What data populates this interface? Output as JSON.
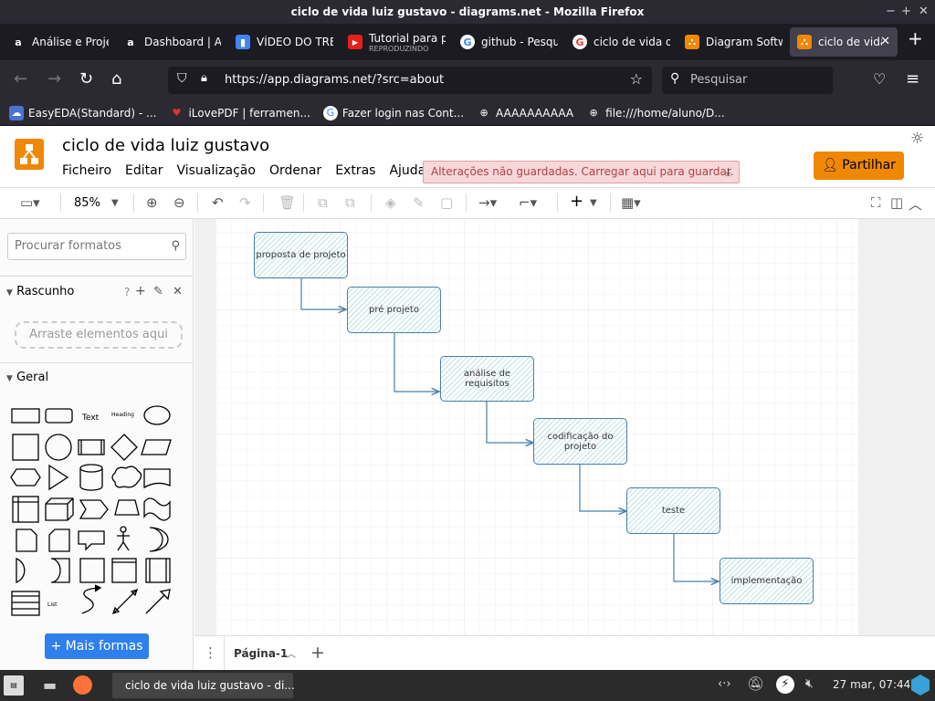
{
  "window": {
    "title": "ciclo de vida luiz gustavo - diagrams.net - Mozilla Firefox"
  },
  "tabs": [
    {
      "label": "Análise e Proje",
      "icon": "a"
    },
    {
      "label": "Dashboard | A",
      "icon": "a"
    },
    {
      "label": "VÍDEO DO TRE",
      "icon": "doc"
    },
    {
      "label": "Tutorial para p",
      "sub": "REPRODUZINDO",
      "icon": "youtube"
    },
    {
      "label": "github - Pesqu",
      "icon": "G"
    },
    {
      "label": "ciclo de vida d",
      "icon": "G"
    },
    {
      "label": "Diagram Softw",
      "icon": "drawio"
    },
    {
      "label": "ciclo de vida",
      "icon": "drawio",
      "active": true
    }
  ],
  "nav": {
    "url": "https://app.diagrams.net/?src=about",
    "url_domain": "diagrams.net",
    "search_placeholder": "Pesquisar"
  },
  "bookmarks": [
    {
      "label": "EasyEDA(Standard) - ..."
    },
    {
      "label": "iLovePDF | ferramen..."
    },
    {
      "label": "Fazer login nas Cont..."
    },
    {
      "label": "AAAAAAAAAA"
    },
    {
      "label": "file:///home/aluno/D..."
    }
  ],
  "app": {
    "doc_title": "ciclo de vida luiz gustavo",
    "menus": [
      "Ficheiro",
      "Editar",
      "Visualização",
      "Ordenar",
      "Extras",
      "Ajuda"
    ],
    "unsaved_notice": "Alterações não guardadas. Carregar aqui para guardar.",
    "share_label": "Partilhar",
    "zoom": "85%"
  },
  "sidebar": {
    "search_placeholder": "Procurar formatos",
    "scratchpad_title": "Rascunho",
    "scratchpad_help": "?",
    "dropzone_text": "Arraste elementos aqui",
    "general_title": "Geral",
    "shape_text": "Text",
    "shape_heading": "Heading",
    "shape_list": "List",
    "more_shapes": "+ Mais formas"
  },
  "diagram": {
    "nodes": [
      {
        "label": "proposta de projeto"
      },
      {
        "label": "pré projeto"
      },
      {
        "label": "análise de requisitos"
      },
      {
        "label": "codificação do projeto"
      },
      {
        "label": "teste"
      },
      {
        "label": "implementação"
      }
    ]
  },
  "pages": {
    "current": "Página-1"
  },
  "taskbar": {
    "window_label": "ciclo de vida luiz gustavo - di...",
    "clock": "27 mar, 07:44"
  },
  "colors": {
    "accent": "#f08705",
    "link_blue": "#2f80ed",
    "node_stroke": "#4a7fa7"
  }
}
